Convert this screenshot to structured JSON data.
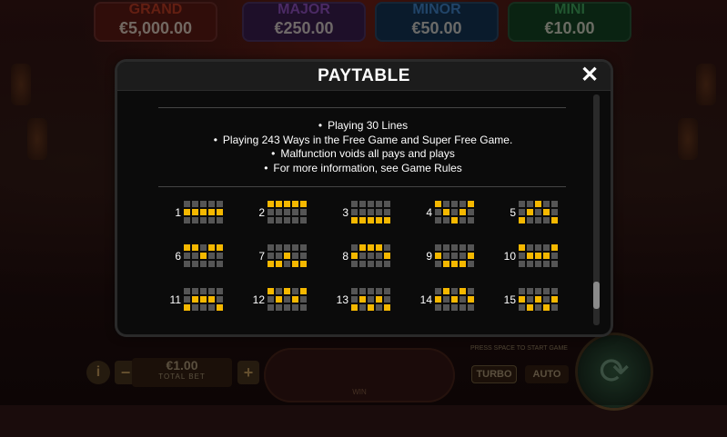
{
  "jackpots": [
    {
      "label": "GRAND",
      "amount": "€5,000.00"
    },
    {
      "label": "MAJOR",
      "amount": "€250.00"
    },
    {
      "label": "MINOR",
      "amount": "€50.00"
    },
    {
      "label": "MINI",
      "amount": "€10.00"
    }
  ],
  "bottom_bar": {
    "info_label": "i",
    "minus_label": "−",
    "plus_label": "+",
    "bet_value": "€1.00",
    "bet_label": "TOTAL BET",
    "win_label": "WIN",
    "press_text": "PRESS SPACE TO START GAME",
    "turbo_label": "TURBO",
    "auto_label": "AUTO"
  },
  "modal": {
    "title": "PAYTABLE",
    "close_label": "✕",
    "notes": [
      "Playing 30 Lines",
      "Playing 243 Ways in the Free Game and Super Free Game.",
      "Malfunction voids all pays and plays",
      "For more information, see Game Rules"
    ],
    "line_color": "#f5b800",
    "cell_color": "#555555",
    "lines": [
      {
        "number": "1",
        "rows": [
          1,
          1,
          1,
          1,
          1
        ]
      },
      {
        "number": "2",
        "rows": [
          0,
          0,
          0,
          0,
          0
        ]
      },
      {
        "number": "3",
        "rows": [
          2,
          2,
          2,
          2,
          2
        ]
      },
      {
        "number": "4",
        "rows": [
          0,
          1,
          2,
          1,
          0
        ]
      },
      {
        "number": "5",
        "rows": [
          2,
          1,
          0,
          1,
          2
        ]
      },
      {
        "number": "6",
        "rows": [
          0,
          0,
          1,
          0,
          0
        ]
      },
      {
        "number": "7",
        "rows": [
          2,
          2,
          1,
          2,
          2
        ]
      },
      {
        "number": "8",
        "rows": [
          1,
          0,
          0,
          0,
          1
        ]
      },
      {
        "number": "9",
        "rows": [
          1,
          2,
          2,
          2,
          1
        ]
      },
      {
        "number": "10",
        "rows": [
          0,
          1,
          1,
          1,
          0
        ]
      },
      {
        "number": "11",
        "rows": [
          2,
          1,
          1,
          1,
          2
        ]
      },
      {
        "number": "12",
        "rows": [
          0,
          1,
          0,
          1,
          0
        ]
      },
      {
        "number": "13",
        "rows": [
          2,
          1,
          2,
          1,
          2
        ]
      },
      {
        "number": "14",
        "rows": [
          1,
          0,
          1,
          0,
          1
        ]
      },
      {
        "number": "15",
        "rows": [
          1,
          2,
          1,
          2,
          1
        ]
      }
    ]
  }
}
